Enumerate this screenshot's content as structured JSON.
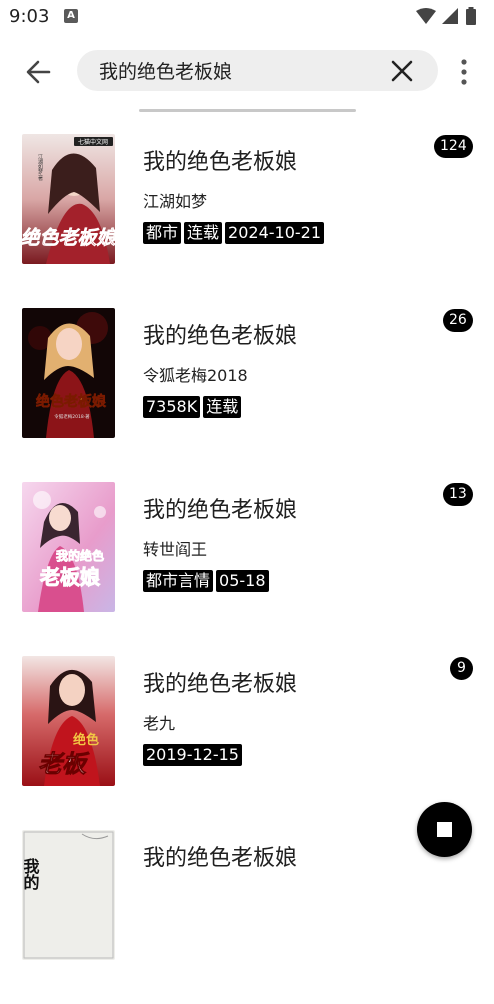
{
  "status_bar": {
    "time": "9:03",
    "notification_icon": "A"
  },
  "header": {
    "back_icon": "arrow-left-icon",
    "search": {
      "value": "我的绝色老板娘",
      "placeholder": ""
    },
    "clear_icon": "close-icon",
    "more_icon": "more-vert-icon"
  },
  "results": [
    {
      "title": "我的绝色老板娘",
      "author": "江湖如梦",
      "tags": [
        "都市",
        "连载",
        "2024-10-21"
      ],
      "count": "124"
    },
    {
      "title": "我的绝色老板娘",
      "author": "令狐老梅2018",
      "tags": [
        "7358K",
        "连载"
      ],
      "count": "26"
    },
    {
      "title": "我的绝色老板娘",
      "author": "转世阎王",
      "tags": [
        "都市言情",
        "05-18"
      ],
      "count": "13"
    },
    {
      "title": "我的绝色老板娘",
      "author": "老九",
      "tags": [
        "2019-12-15"
      ],
      "count": "9"
    },
    {
      "title": "我的绝色老板娘",
      "author": "",
      "tags": [],
      "count": ""
    }
  ],
  "covers": [
    {
      "text": "绝色老板娘",
      "top_text": "七猫中文网",
      "small_text": "江湖如梦·著"
    },
    {
      "text": "绝色老板娘",
      "top_text": "",
      "small_text": "令狐老梅2018·著"
    },
    {
      "text": "老板娘",
      "top_text": "",
      "small_text": "我的绝色"
    },
    {
      "text": "老板",
      "top_text": "",
      "small_text": "绝色"
    },
    {
      "text": "我的",
      "top_text": "",
      "small_text": ""
    }
  ],
  "fab_icon": "stop-icon",
  "colors": {
    "accent": "#000000",
    "search_bg": "#eeeeee",
    "text": "#202020"
  }
}
